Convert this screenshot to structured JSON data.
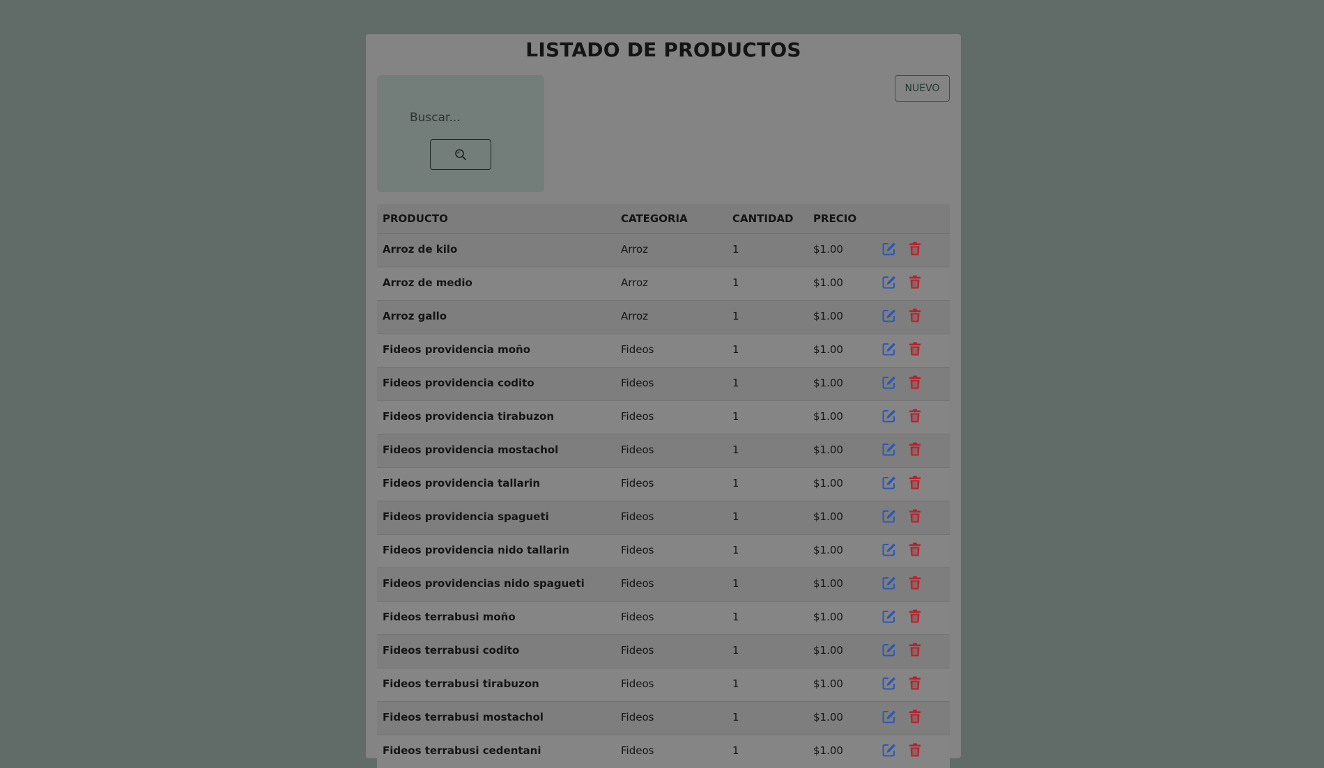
{
  "page": {
    "title": "LISTADO DE PRODUCTOS"
  },
  "search": {
    "placeholder": "Buscar...",
    "button_icon": "search-icon"
  },
  "toolbar": {
    "new_label": "NUEVO"
  },
  "colors": {
    "edit_icon": "#2b58b8",
    "delete_icon": "#b7222c"
  },
  "table": {
    "headers": [
      "PRODUCTO",
      "CATEGORIA",
      "CANTIDAD",
      "PRECIO"
    ],
    "rows": [
      {
        "product": "Arroz de kilo",
        "category": "Arroz",
        "quantity": "1",
        "price": "$1.00"
      },
      {
        "product": "Arroz de medio",
        "category": "Arroz",
        "quantity": "1",
        "price": "$1.00"
      },
      {
        "product": "Arroz gallo",
        "category": "Arroz",
        "quantity": "1",
        "price": "$1.00"
      },
      {
        "product": "Fideos providencia moño",
        "category": "Fideos",
        "quantity": "1",
        "price": "$1.00"
      },
      {
        "product": "Fideos providencia codito",
        "category": "Fideos",
        "quantity": "1",
        "price": "$1.00"
      },
      {
        "product": "Fideos providencia tirabuzon",
        "category": "Fideos",
        "quantity": "1",
        "price": "$1.00"
      },
      {
        "product": "Fideos providencia mostachol",
        "category": "Fideos",
        "quantity": "1",
        "price": "$1.00"
      },
      {
        "product": "Fideos providencia tallarin",
        "category": "Fideos",
        "quantity": "1",
        "price": "$1.00"
      },
      {
        "product": "Fideos providencia spagueti",
        "category": "Fideos",
        "quantity": "1",
        "price": "$1.00"
      },
      {
        "product": "Fideos providencia nido tallarin",
        "category": "Fideos",
        "quantity": "1",
        "price": "$1.00"
      },
      {
        "product": "Fideos providencias nido spagueti",
        "category": "Fideos",
        "quantity": "1",
        "price": "$1.00"
      },
      {
        "product": "Fideos terrabusi moño",
        "category": "Fideos",
        "quantity": "1",
        "price": "$1.00"
      },
      {
        "product": "Fideos terrabusi codito",
        "category": "Fideos",
        "quantity": "1",
        "price": "$1.00"
      },
      {
        "product": "Fideos terrabusi tirabuzon",
        "category": "Fideos",
        "quantity": "1",
        "price": "$1.00"
      },
      {
        "product": "Fideos terrabusi mostachol",
        "category": "Fideos",
        "quantity": "1",
        "price": "$1.00"
      },
      {
        "product": "Fideos terrabusi cedentani",
        "category": "Fideos",
        "quantity": "1",
        "price": "$1.00"
      }
    ]
  }
}
